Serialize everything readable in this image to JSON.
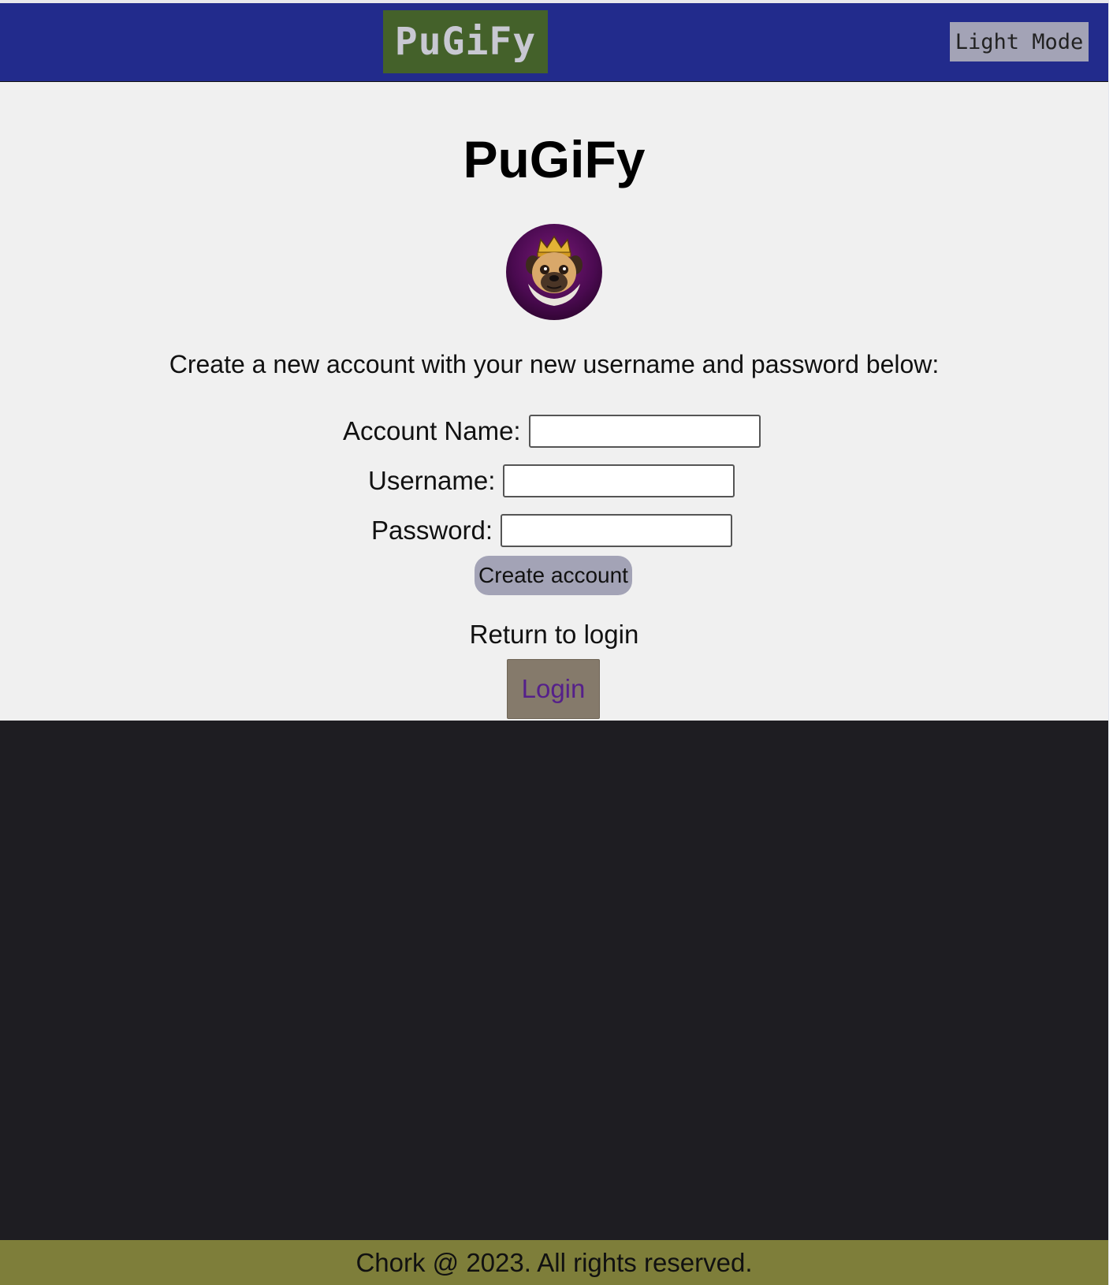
{
  "header": {
    "brand": "PuGiFy",
    "mode_toggle_label": "Light Mode"
  },
  "main": {
    "title": "PuGiFy",
    "logo_icon": "crowned-pug-icon",
    "intro": "Create a new account with your new username and password below:",
    "form": {
      "account_name_label": "Account Name:",
      "account_name_value": "",
      "username_label": "Username:",
      "username_value": "",
      "password_label": "Password:",
      "password_value": "",
      "submit_label": "Create account"
    },
    "return_text": "Return to login",
    "login_label": "Login"
  },
  "footer": {
    "text": "Chork @ 2023. All rights reserved."
  },
  "colors": {
    "header_bg": "#222b8c",
    "brand_bg": "#44612a",
    "main_bg": "#f0f0f0",
    "dark_area_bg": "#1e1d22",
    "footer_bg": "#7e7e3a",
    "button_bg": "#a3a3b6",
    "login_bg": "#857a6b"
  }
}
